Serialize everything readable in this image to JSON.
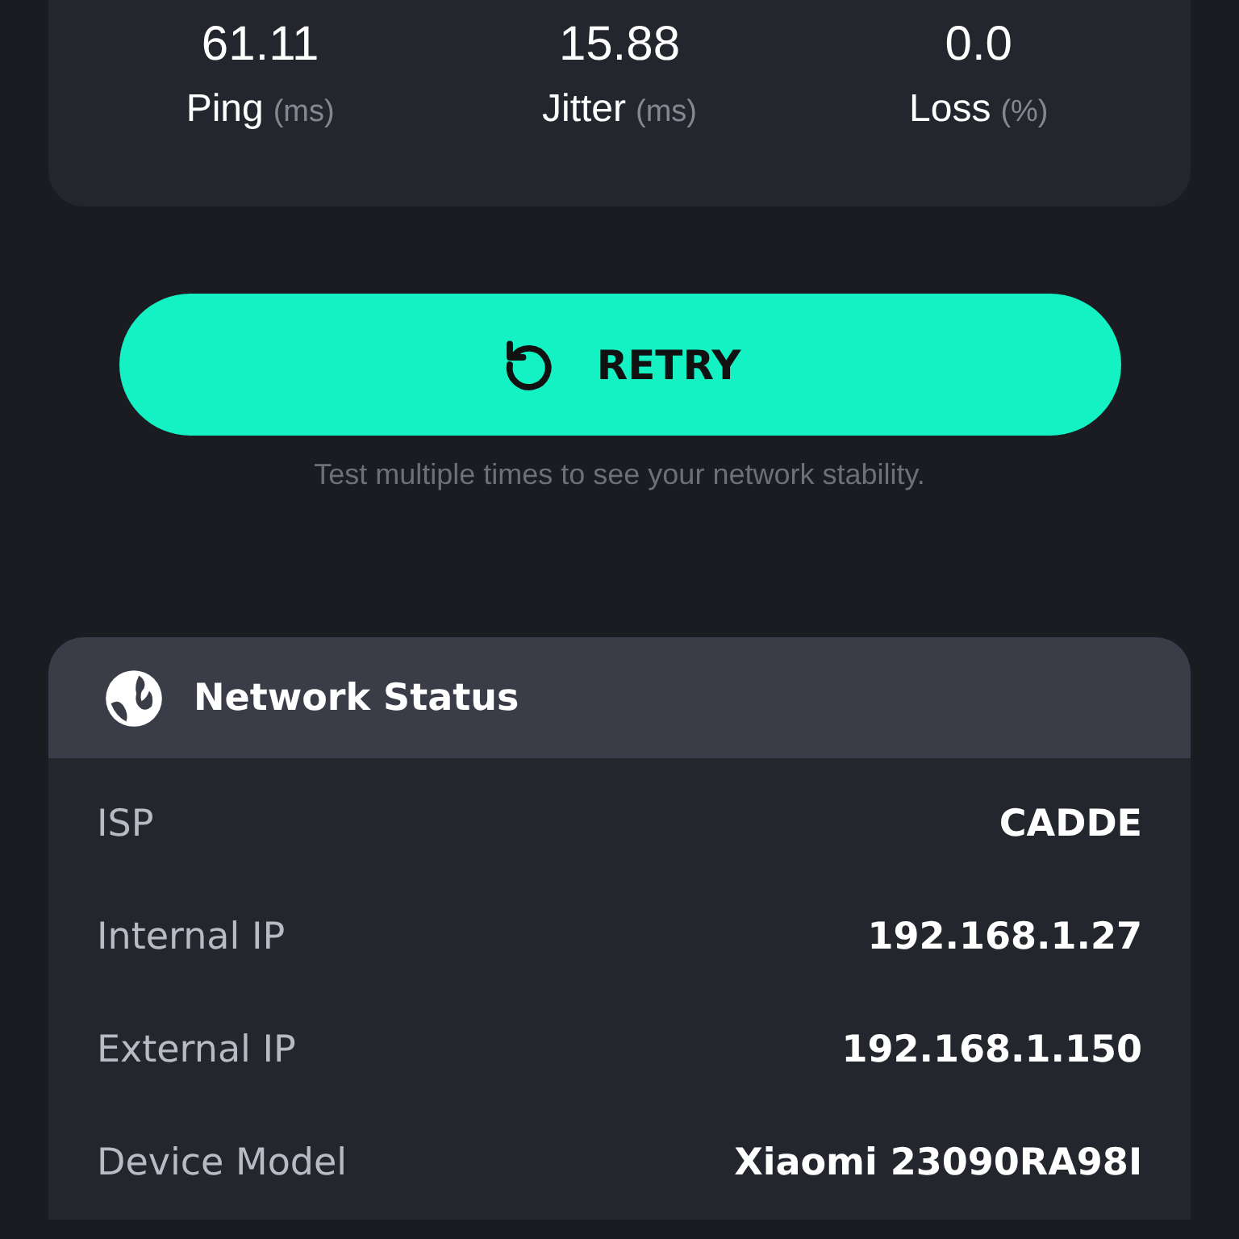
{
  "metrics": [
    {
      "value": "61.11",
      "label": "Ping",
      "unit": "(ms)"
    },
    {
      "value": "15.88",
      "label": "Jitter",
      "unit": "(ms)"
    },
    {
      "value": "0.0",
      "label": "Loss",
      "unit": "(%)"
    }
  ],
  "retry_button": {
    "label": "RETRY"
  },
  "hint": "Test multiple times to see your network stability.",
  "network_status": {
    "title": "Network Status",
    "rows": [
      {
        "label": "ISP",
        "value": "CADDE"
      },
      {
        "label": "Internal IP",
        "value": "192.168.1.27"
      },
      {
        "label": "External IP",
        "value": "192.168.1.150"
      },
      {
        "label": "Device Model",
        "value": "Xiaomi 23090RA98I"
      }
    ]
  }
}
